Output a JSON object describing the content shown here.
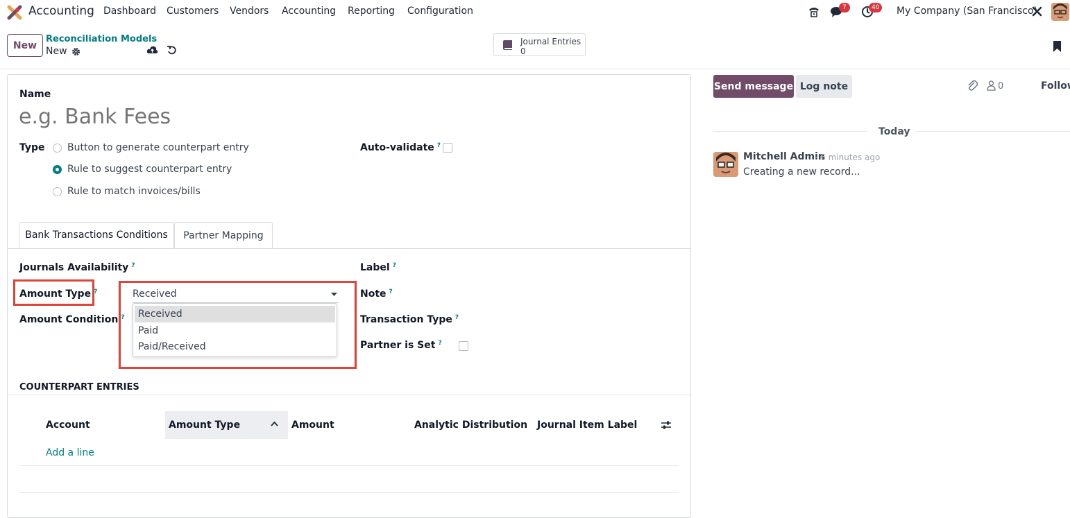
{
  "navbar": {
    "app_name": "Accounting",
    "menu": [
      "Dashboard",
      "Customers",
      "Vendors",
      "Accounting",
      "Reporting",
      "Configuration"
    ],
    "messages_count": "7",
    "activities_count": "40",
    "company": "My Company (San Francisco)"
  },
  "control_panel": {
    "new_label": "New",
    "breadcrumb_parent": "Reconciliation Models",
    "breadcrumb_current": "New",
    "smart_button_label": "Journal Entries",
    "smart_button_value": "0"
  },
  "form": {
    "name_label": "Name",
    "name_placeholder": "e.g. Bank Fees",
    "type_label": "Type",
    "type_options": [
      {
        "label": "Button to generate counterpart entry",
        "selected": false
      },
      {
        "label": "Rule to suggest counterpart entry",
        "selected": true
      },
      {
        "label": "Rule to match invoices/bills",
        "selected": false
      }
    ],
    "auto_validate_label": "Auto-validate",
    "help_mark": "?",
    "tabs": [
      "Bank Transactions Conditions",
      "Partner Mapping"
    ],
    "left_fields": [
      "Journals Availability",
      "Amount Type",
      "Amount Condition"
    ],
    "right_fields": [
      "Label",
      "Note",
      "Transaction Type",
      "Partner is Set"
    ],
    "amount_type_value": "Received",
    "amount_type_options": [
      "Received",
      "Paid",
      "Paid/Received"
    ],
    "counterpart_title": "COUNTERPART ENTRIES",
    "columns": [
      "Account",
      "Amount Type",
      "Amount",
      "Analytic Distribution",
      "Journal Item Label"
    ],
    "add_line": "Add a line"
  },
  "chatter": {
    "send_message": "Send message",
    "log_note": "Log note",
    "followers_count": "0",
    "follow_label": "Follow",
    "date_separator": "Today",
    "author": "Mitchell Admin",
    "time": "- 6 minutes ago",
    "message": "Creating a new record..."
  },
  "colors": {
    "primary": "#714b67",
    "accent": "#017e84",
    "highlight": "#e0433a"
  }
}
